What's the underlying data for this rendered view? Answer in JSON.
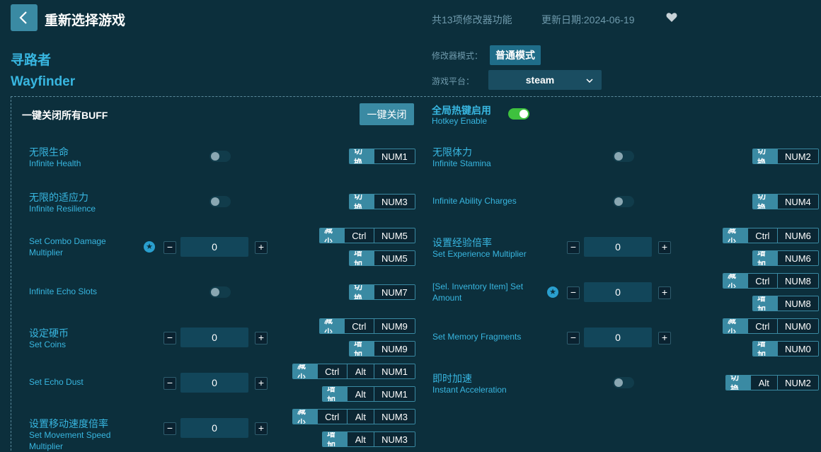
{
  "header": {
    "title": "重新选择游戏",
    "feature_count": "共13项修改器功能",
    "update_date": "更新日期:2024-06-19"
  },
  "game": {
    "name_cn": "寻路者",
    "name_en": "Wayfinder"
  },
  "settings": {
    "mode_label": "修改器模式：",
    "mode_value": "普通模式",
    "platform_label": "游戏平台：",
    "platform_value": "steam"
  },
  "global": {
    "close_all_label": "一键关闭所有BUFF",
    "close_all_button": "一键关闭",
    "hotkey_cn": "全局热键启用",
    "hotkey_en": "Hotkey Enable",
    "hotkey_enabled": true
  },
  "items": [
    {
      "cn": "无限生命",
      "en": "Infinite Health",
      "control": "toggle",
      "keys": [
        {
          "tag": "切换",
          "keys": [
            "NUM1"
          ]
        }
      ]
    },
    {
      "cn": "无限体力",
      "en": "Infinite Stamina",
      "control": "toggle",
      "keys": [
        {
          "tag": "切换",
          "keys": [
            "NUM2"
          ]
        }
      ]
    },
    {
      "cn": "无限的适应力",
      "en": "Infinite Resilience",
      "control": "toggle",
      "keys": [
        {
          "tag": "切换",
          "keys": [
            "NUM3"
          ]
        }
      ]
    },
    {
      "cn": "",
      "en": "Infinite Ability Charges",
      "control": "toggle",
      "keys": [
        {
          "tag": "切换",
          "keys": [
            "NUM4"
          ]
        }
      ]
    },
    {
      "cn": "",
      "en": "Set Combo Damage Multiplier",
      "control": "number",
      "value": "0",
      "star": true,
      "keys": [
        {
          "tag": "减少",
          "keys": [
            "Ctrl",
            "NUM5"
          ]
        },
        {
          "tag": "增加",
          "keys": [
            "NUM5"
          ]
        }
      ]
    },
    {
      "cn": "设置经验倍率",
      "en": "Set Experience Multiplier",
      "control": "number",
      "value": "0",
      "keys": [
        {
          "tag": "减少",
          "keys": [
            "Ctrl",
            "NUM6"
          ]
        },
        {
          "tag": "增加",
          "keys": [
            "NUM6"
          ]
        }
      ]
    },
    {
      "cn": "",
      "en": "Infinite Echo Slots",
      "control": "toggle",
      "keys": [
        {
          "tag": "切换",
          "keys": [
            "NUM7"
          ]
        }
      ]
    },
    {
      "cn": "",
      "en": "[Sel. Inventory Item] Set Amount",
      "control": "number",
      "value": "0",
      "star": true,
      "keys": [
        {
          "tag": "减少",
          "keys": [
            "Ctrl",
            "NUM8"
          ]
        },
        {
          "tag": "增加",
          "keys": [
            "NUM8"
          ]
        }
      ]
    },
    {
      "cn": "设定硬币",
      "en": "Set Coins",
      "control": "number",
      "value": "0",
      "keys": [
        {
          "tag": "减少",
          "keys": [
            "Ctrl",
            "NUM9"
          ]
        },
        {
          "tag": "增加",
          "keys": [
            "NUM9"
          ]
        }
      ]
    },
    {
      "cn": "",
      "en": "Set Memory Fragments",
      "control": "number",
      "value": "0",
      "keys": [
        {
          "tag": "减少",
          "keys": [
            "Ctrl",
            "NUM0"
          ]
        },
        {
          "tag": "增加",
          "keys": [
            "NUM0"
          ]
        }
      ]
    },
    {
      "cn": "",
      "en": "Set Echo Dust",
      "control": "number",
      "value": "0",
      "keys": [
        {
          "tag": "减少",
          "keys": [
            "Ctrl",
            "Alt",
            "NUM1"
          ]
        },
        {
          "tag": "增加",
          "keys": [
            "Alt",
            "NUM1"
          ]
        }
      ]
    },
    {
      "cn": "即时加速",
      "en": "Instant Acceleration",
      "control": "toggle",
      "keys": [
        {
          "tag": "切换",
          "keys": [
            "Alt",
            "NUM2"
          ]
        }
      ]
    },
    {
      "cn": "设置移动速度倍率",
      "en": "Set Movement Speed Multiplier",
      "control": "number",
      "value": "0",
      "keys": [
        {
          "tag": "减少",
          "keys": [
            "Ctrl",
            "Alt",
            "NUM3"
          ]
        },
        {
          "tag": "增加",
          "keys": [
            "Alt",
            "NUM3"
          ]
        }
      ]
    }
  ],
  "colors": {
    "background": "#0c2f3c",
    "accent": "#3a8aa3",
    "text_blue": "#38b6e0",
    "toggle_on": "#3ec13e"
  },
  "icons": {
    "back": "chevron-left-icon",
    "favorite": "heart-icon",
    "dropdown": "chevron-down-icon",
    "star": "star-icon"
  }
}
